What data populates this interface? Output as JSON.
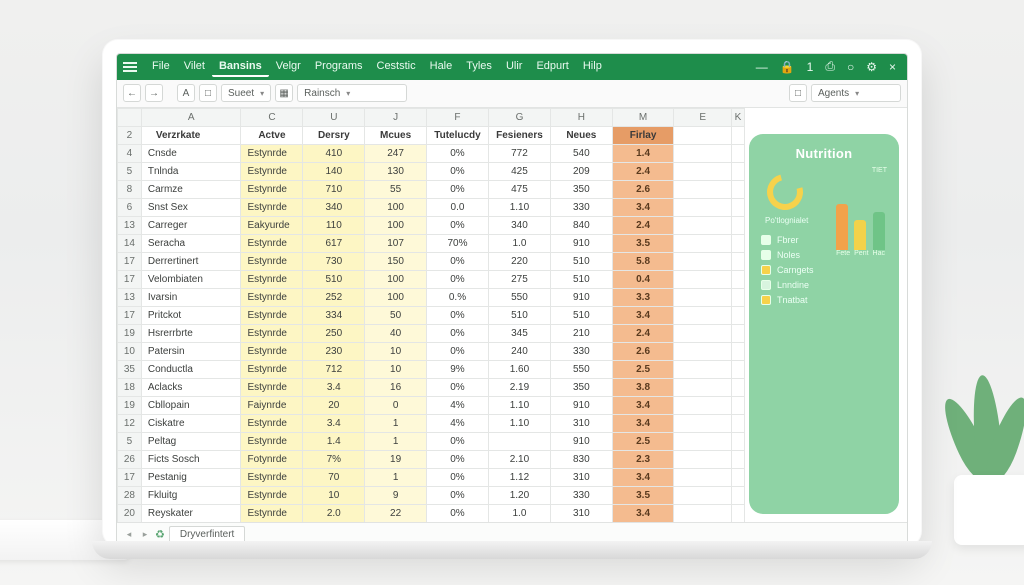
{
  "colors": {
    "brand": "#1e8d4b",
    "accentYellow": "#fdf6c4",
    "accentOrange": "#f4bb8f",
    "panel": "#8fd3a5"
  },
  "menu": {
    "items": [
      "File",
      "Vilet",
      "Bansins",
      "Velgr",
      "Programs",
      "Ceststic",
      "Hale",
      "Tyles",
      "Ulir",
      "Edpurt",
      "Hilp"
    ],
    "activeIndex": 2
  },
  "windowControls": {
    "minimize": "—",
    "lock": "🔒",
    "one": "1",
    "pin": "⎙",
    "orb": "○",
    "gear": "⚙",
    "close": "×"
  },
  "toolbar": {
    "undo": "←",
    "redo": "→",
    "boxA": "A",
    "box1": "□",
    "sheetDD": {
      "label": "Sueet",
      "chev": "▾"
    },
    "box2": "▦",
    "fontDD": {
      "label": "Rainsch",
      "chev": "▾"
    },
    "farRight": {
      "box": "□",
      "agents": {
        "label": "Agents",
        "chev": "▾"
      }
    }
  },
  "columns": [
    "A",
    "C",
    "U",
    "J",
    "F",
    "G",
    "H",
    "M",
    "E",
    "K"
  ],
  "headerRow": [
    "Verzrkate",
    "Actve",
    "Dersry",
    "Mcues",
    "Tutelucdy",
    "Fesieners",
    "Neues",
    "Firlay"
  ],
  "rows": [
    {
      "n": "4",
      "cells": [
        "Cnsde",
        "Estynrde",
        "410",
        "247",
        "0%",
        "772",
        "540",
        "1.4"
      ]
    },
    {
      "n": "5",
      "cells": [
        "Tnlnda",
        "Estynrde",
        "140",
        "130",
        "0%",
        "425",
        "209",
        "2.4"
      ]
    },
    {
      "n": "8",
      "cells": [
        "Carmze",
        "Estynrde",
        "710",
        "55",
        "0%",
        "475",
        "350",
        "2.6"
      ]
    },
    {
      "n": "6",
      "cells": [
        "Snst Sex",
        "Estynrde",
        "340",
        "100",
        "0.0",
        "1.10",
        "330",
        "3.4"
      ]
    },
    {
      "n": "13",
      "cells": [
        "Carreger",
        "Eakyurde",
        "110",
        "100",
        "0%",
        "340",
        "840",
        "2.4"
      ]
    },
    {
      "n": "14",
      "cells": [
        "Seracha",
        "Estynrde",
        "617",
        "107",
        "70%",
        "1.0",
        "910",
        "3.5"
      ]
    },
    {
      "n": "17",
      "cells": [
        "Derrertinert",
        "Estynrde",
        "730",
        "150",
        "0%",
        "220",
        "510",
        "5.8"
      ]
    },
    {
      "n": "17",
      "cells": [
        "Velombiaten",
        "Estynrde",
        "510",
        "100",
        "0%",
        "275",
        "510",
        "0.4"
      ]
    },
    {
      "n": "13",
      "cells": [
        "Ivarsin",
        "Estynrde",
        "252",
        "100",
        "0.%",
        "550",
        "910",
        "3.3"
      ]
    },
    {
      "n": "17",
      "cells": [
        "Pritckot",
        "Estynrde",
        "334",
        "50",
        "0%",
        "510",
        "510",
        "3.4"
      ]
    },
    {
      "n": "19",
      "cells": [
        "Hsrerrbrte",
        "Estynrde",
        "250",
        "40",
        "0%",
        "345",
        "210",
        "2.4"
      ]
    },
    {
      "n": "10",
      "cells": [
        "Patersin",
        "Estynrde",
        "230",
        "10",
        "0%",
        "240",
        "330",
        "2.6"
      ]
    },
    {
      "n": "35",
      "cells": [
        "Conductla",
        "Estynrde",
        "712",
        "10",
        "9%",
        "1.60",
        "550",
        "2.5"
      ]
    },
    {
      "n": "18",
      "cells": [
        "Aclacks",
        "Estynrde",
        "3.4",
        "16",
        "0%",
        "2.19",
        "350",
        "3.8"
      ]
    },
    {
      "n": "19",
      "cells": [
        "Cbllopain",
        "Faiynrde",
        "20",
        "0",
        "4%",
        "1.10",
        "910",
        "3.4"
      ]
    },
    {
      "n": "12",
      "cells": [
        "Ciskatre",
        "Estynrde",
        "3.4",
        "1",
        "4%",
        "1.10",
        "310",
        "3.4"
      ]
    },
    {
      "n": "5",
      "cells": [
        "Peltag",
        "Estynrde",
        "1.4",
        "1",
        "0%",
        "",
        "910",
        "2.5"
      ]
    },
    {
      "n": "26",
      "cells": [
        "Ficts Sosch",
        "Fotynrde",
        "7%",
        "19",
        "0%",
        "2.10",
        "830",
        "2.3"
      ]
    },
    {
      "n": "17",
      "cells": [
        "Pestanig",
        "Estynrde",
        "70",
        "1",
        "0%",
        "1.12",
        "310",
        "3.4"
      ]
    },
    {
      "n": "28",
      "cells": [
        "Fkluitg",
        "Estynrde",
        "10",
        "9",
        "0%",
        "1.20",
        "330",
        "3.5"
      ]
    },
    {
      "n": "20",
      "cells": [
        "Reyskater",
        "Estynrde",
        "2.0",
        "22",
        "0%",
        "1.0",
        "310",
        "3.4"
      ]
    }
  ],
  "panel": {
    "title": "Nutrition",
    "toptag": "TIET",
    "subtag": "Po'tlognialet",
    "legend": [
      {
        "label": "Fbrer",
        "color": "#e7ffe9"
      },
      {
        "label": "Noles",
        "color": "#e7ffe9"
      },
      {
        "label": "Carngets",
        "color": "#f7d24b"
      },
      {
        "label": "Lnndine",
        "color": "#d8f4df"
      },
      {
        "label": "Tnatbat",
        "color": "#f7d24b"
      }
    ],
    "bars": [
      {
        "h": 46,
        "c": "#f2a24a",
        "label": "Fete"
      },
      {
        "h": 30,
        "c": "#f2d24a",
        "label": "Pent"
      },
      {
        "h": 38,
        "c": "#6fc487",
        "label": "Hac"
      }
    ]
  },
  "tabs": {
    "name": "Dryverfintert"
  },
  "chart_data": [
    {
      "type": "table",
      "title": "Nutrition sheet",
      "columns": [
        "Verzrkate",
        "Actve",
        "Dersry",
        "Mcues",
        "Tutelucdy",
        "Fesieners",
        "Neues",
        "Firlay"
      ],
      "rows": [
        [
          "Cnsde",
          "Estynrde",
          410,
          247,
          "0%",
          772,
          540,
          1.4
        ],
        [
          "Tnlnda",
          "Estynrde",
          140,
          130,
          "0%",
          425,
          209,
          2.4
        ],
        [
          "Carmze",
          "Estynrde",
          710,
          55,
          "0%",
          475,
          350,
          2.6
        ],
        [
          "Snst Sex",
          "Estynrde",
          340,
          100,
          "0.0",
          1.1,
          330,
          3.4
        ],
        [
          "Carreger",
          "Eakyurde",
          110,
          100,
          "0%",
          340,
          840,
          2.4
        ],
        [
          "Seracha",
          "Estynrde",
          617,
          107,
          "70%",
          1.0,
          910,
          3.5
        ],
        [
          "Derrertinert",
          "Estynrde",
          730,
          150,
          "0%",
          220,
          510,
          5.8
        ],
        [
          "Velombiaten",
          "Estynrde",
          510,
          100,
          "0%",
          275,
          510,
          0.4
        ],
        [
          "Ivarsin",
          "Estynrde",
          252,
          100,
          "0.%",
          550,
          910,
          3.3
        ],
        [
          "Pritckot",
          "Estynrde",
          334,
          50,
          "0%",
          510,
          510,
          3.4
        ],
        [
          "Hsrerrbrte",
          "Estynrde",
          250,
          40,
          "0%",
          345,
          210,
          2.4
        ],
        [
          "Patersin",
          "Estynrde",
          230,
          10,
          "0%",
          240,
          330,
          2.6
        ],
        [
          "Conductla",
          "Estynrde",
          712,
          10,
          "9%",
          1.6,
          550,
          2.5
        ],
        [
          "Aclacks",
          "Estynrde",
          3.4,
          16,
          "0%",
          2.19,
          350,
          3.8
        ],
        [
          "Cbllopain",
          "Faiynrde",
          20,
          0,
          "4%",
          1.1,
          910,
          3.4
        ],
        [
          "Ciskatre",
          "Estynrde",
          3.4,
          1,
          "4%",
          1.1,
          310,
          3.4
        ],
        [
          "Peltag",
          "Estynrde",
          1.4,
          1,
          "0%",
          null,
          910,
          2.5
        ],
        [
          "Ficts Sosch",
          "Fotynrde",
          "7%",
          19,
          "0%",
          2.1,
          830,
          2.3
        ],
        [
          "Pestanig",
          "Estynrde",
          70,
          1,
          "0%",
          1.12,
          310,
          3.4
        ],
        [
          "Fkluitg",
          "Estynrde",
          10,
          9,
          "0%",
          1.2,
          330,
          3.5
        ],
        [
          "Reyskater",
          "Estynrde",
          2.0,
          22,
          "0%",
          1.0,
          310,
          3.4
        ]
      ]
    },
    {
      "type": "bar",
      "title": "Nutrition panel bars",
      "categories": [
        "Fete",
        "Pent",
        "Hac"
      ],
      "values": [
        46,
        30,
        38
      ],
      "ylim": [
        0,
        60
      ]
    }
  ]
}
